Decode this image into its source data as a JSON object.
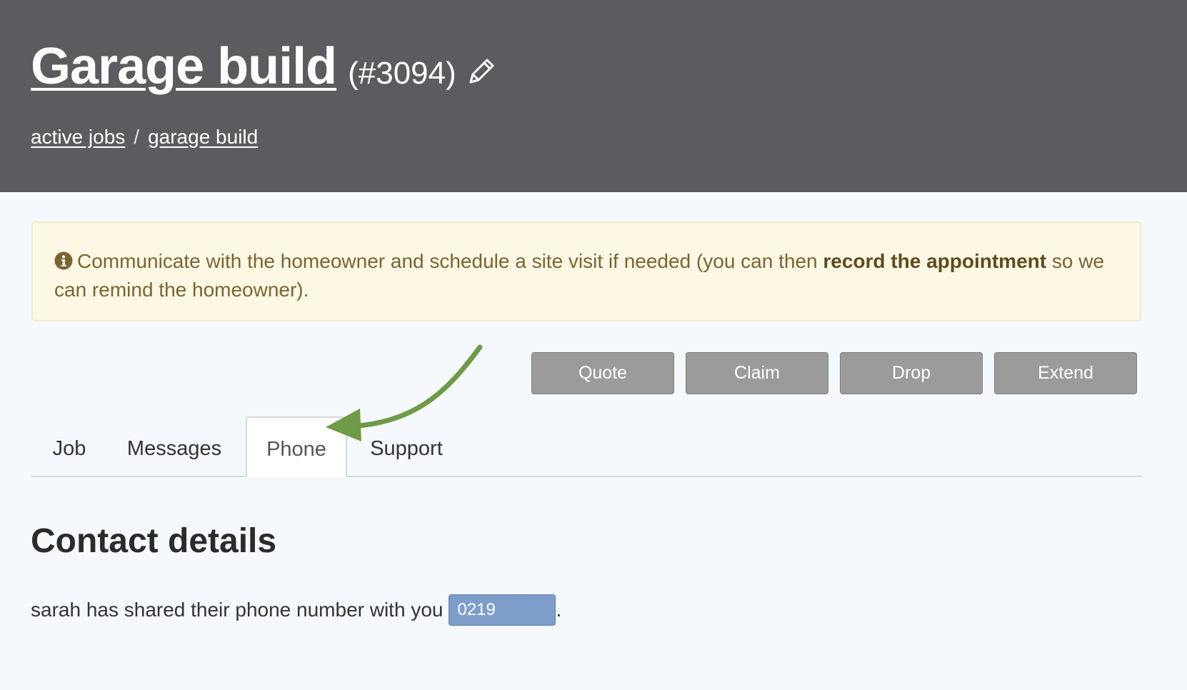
{
  "header": {
    "title": "Garage build",
    "job_number": "(#3094)",
    "edit_icon": "pencil-icon",
    "breadcrumb": {
      "items": [
        "active jobs",
        "garage build"
      ],
      "separator": "/"
    }
  },
  "notice": {
    "icon": "info-icon",
    "text_before": "Communicate with the homeowner and schedule a site visit if needed (you can then ",
    "text_bold": "record the appointment",
    "text_after": " so we can remind the homeowner)."
  },
  "actions": {
    "quote": "Quote",
    "claim": "Claim",
    "drop": "Drop",
    "extend": "Extend"
  },
  "tabs": {
    "items": [
      "Job",
      "Messages",
      "Phone",
      "Support"
    ],
    "active": "Phone"
  },
  "annotation": {
    "arrow_color": "#6f9a47",
    "points_to": "Phone"
  },
  "contact": {
    "title": "Contact details",
    "share_text": "sarah has shared their phone number with you",
    "phone_value": "0219",
    "trailing_punct": "."
  },
  "colors": {
    "header_bg": "#5b5c5f",
    "notice_bg": "#fcf8e4",
    "notice_text": "#7a6432",
    "button_bg": "#9b9b9b",
    "phone_field_bg": "#7d9ecb",
    "page_bg": "#f5f8fc"
  }
}
